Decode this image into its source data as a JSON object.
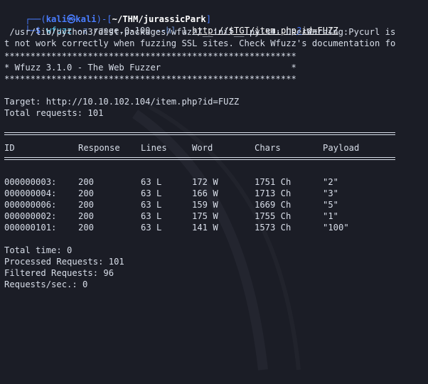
{
  "prompt": {
    "corner_top": "┌──(",
    "user": "kali",
    "at_icon": "㉿",
    "host": "kali",
    "mid": ")-[",
    "path": "~/THM/jurassicPark",
    "close": "]",
    "corner_bottom": "└─",
    "dollar": "$",
    "cmd": "wfuzz",
    "args_1": "-z",
    "args_2": "range,0-100",
    "args_3": "--hl",
    "args_4": "1",
    "url_1": "http://$TGT/item.php",
    "url_q": "?",
    "url_2": "id=FUZZ"
  },
  "warning": {
    "line1": " /usr/lib/python3/dist-packages/wfuzz/__init__.py:34: UserWarning:Pycurl is",
    "line2": "t not work correctly when fuzzing SSL sites. Check Wfuzz's documentation fo"
  },
  "banner": {
    "stars": "********************************************************",
    "title": "* Wfuzz 3.1.0 - The Web Fuzzer                         *"
  },
  "target": {
    "target_line": "Target: http://10.10.102.104/item.php?id=FUZZ",
    "total_requests": "Total requests: 101"
  },
  "table": {
    "headers": {
      "id": "ID",
      "response": "Response",
      "lines": "Lines",
      "word": "Word",
      "chars": "Chars",
      "payload": "Payload"
    },
    "rows": [
      {
        "id": "000000003:",
        "response": "200",
        "lines": "63 L",
        "word": "172 W",
        "chars": "1751 Ch",
        "payload": "\"2\""
      },
      {
        "id": "000000004:",
        "response": "200",
        "lines": "63 L",
        "word": "166 W",
        "chars": "1713 Ch",
        "payload": "\"3\""
      },
      {
        "id": "000000006:",
        "response": "200",
        "lines": "63 L",
        "word": "159 W",
        "chars": "1669 Ch",
        "payload": "\"5\""
      },
      {
        "id": "000000002:",
        "response": "200",
        "lines": "63 L",
        "word": "175 W",
        "chars": "1755 Ch",
        "payload": "\"1\""
      },
      {
        "id": "000000101:",
        "response": "200",
        "lines": "63 L",
        "word": "141 W",
        "chars": "1573 Ch",
        "payload": "\"100\""
      }
    ]
  },
  "summary": {
    "total_time": "Total time: 0",
    "processed": "Processed Requests: 101",
    "filtered": "Filtered Requests: 96",
    "rate": "Requests/sec.: 0"
  },
  "colors": {
    "background": "#1b1d26",
    "prompt_blue": "#4a7dff",
    "command_cyan": "#57d5ff",
    "text": "#d8dee9"
  }
}
